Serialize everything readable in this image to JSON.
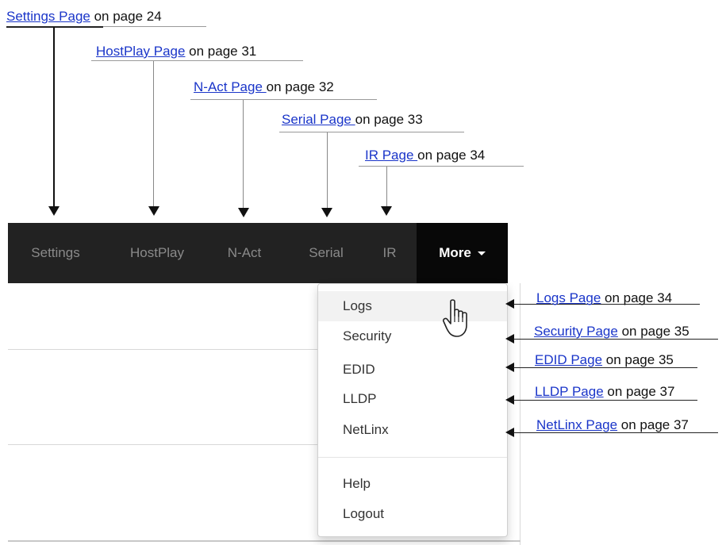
{
  "callouts_top": [
    {
      "link": "Settings Page",
      "text": " on page 24"
    },
    {
      "link": "HostPlay Page",
      "text": " on page 31"
    },
    {
      "link": "N-Act Page ",
      "text": " on page 32"
    },
    {
      "link": "Serial Page ",
      "text": " on page 33"
    },
    {
      "link": "IR Page ",
      "text": " on page 34"
    }
  ],
  "navbar": {
    "items": [
      "Settings",
      "HostPlay",
      "N-Act",
      "Serial",
      "IR"
    ],
    "more_label": "More"
  },
  "dropdown": {
    "items": [
      "Logs",
      "Security",
      "EDID",
      "LLDP",
      "NetLinx"
    ],
    "footer_items": [
      "Help",
      "Logout"
    ]
  },
  "callouts_right": [
    {
      "link": "Logs Page",
      "text": " on page 34"
    },
    {
      "link": "Security Page",
      "text": " on page 35"
    },
    {
      "link": "EDID Page",
      "text": " on page 35"
    },
    {
      "link": "LLDP Page",
      "text": " on page 37"
    },
    {
      "link": "NetLinx Page",
      "text": " on page 37"
    }
  ]
}
